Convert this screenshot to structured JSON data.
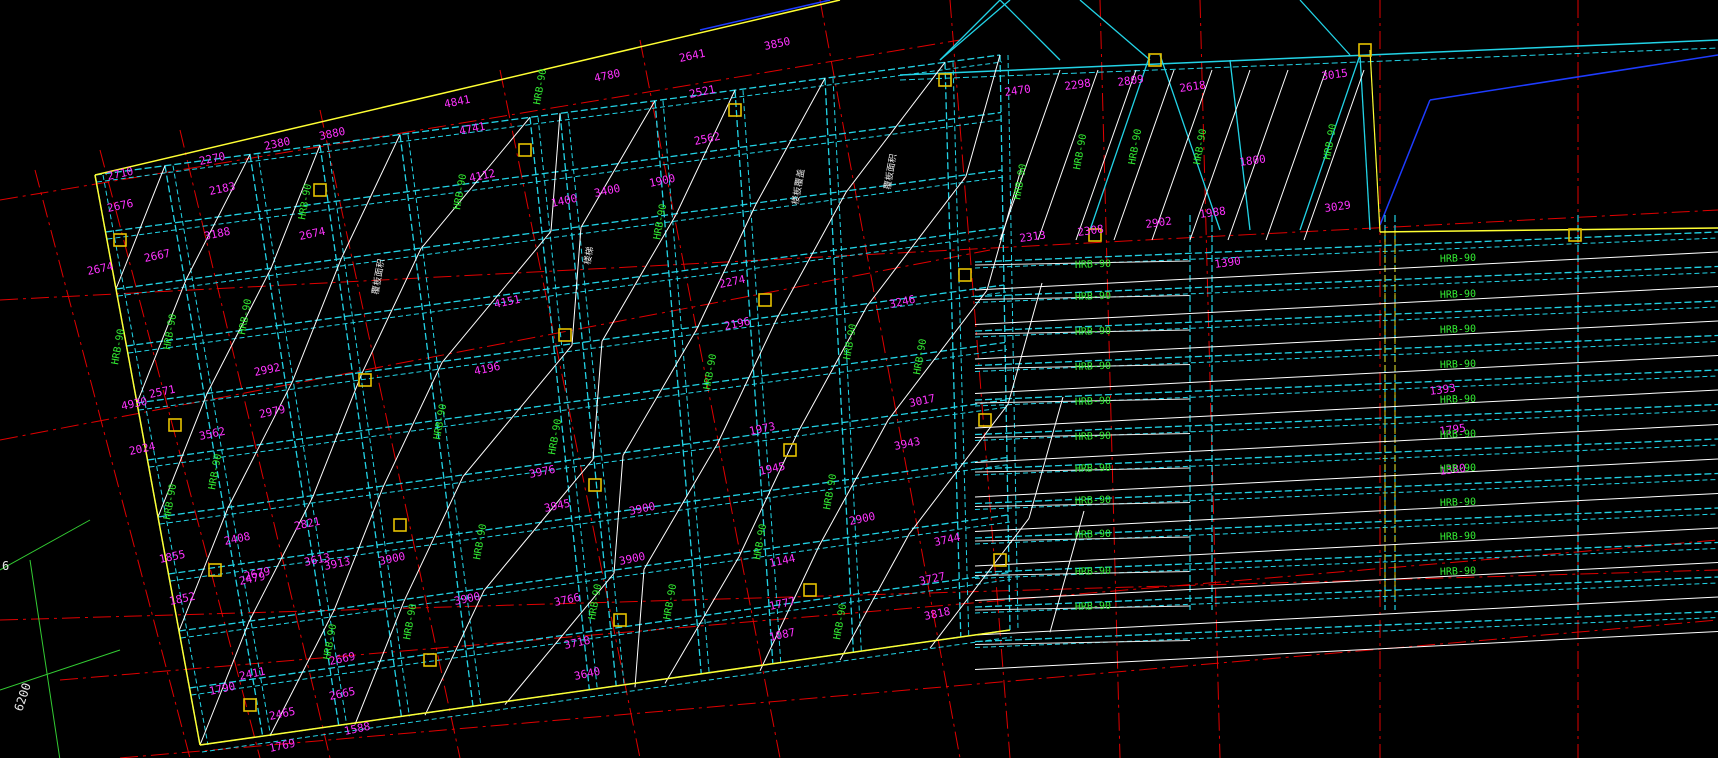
{
  "drawing": {
    "colors": {
      "background": "#000000",
      "grid_axis": "#e00000",
      "beam": "#22d3e6",
      "brace": "#ffffff",
      "dimension": "#ff33ff",
      "panel_label": "#33ee33",
      "outline": "#ffff33",
      "column": "#e6c200",
      "blue_line": "#1e3cff"
    },
    "axis_labels": [
      "6200",
      "6"
    ],
    "panel_label_text": "HRB-90",
    "dimensions_left": [
      "2710",
      "2676",
      "2674",
      "2667",
      "3188",
      "2270",
      "2183",
      "2380",
      "3880",
      "2571",
      "2992",
      "4930",
      "2979",
      "3562",
      "4741",
      "4112",
      "2674",
      "2679",
      "2024",
      "3613",
      "1855",
      "2408",
      "2821",
      "3913",
      "2479",
      "3900",
      "1852",
      "2411",
      "1790",
      "2669",
      "2665",
      "2465",
      "1588",
      "1769",
      "4151",
      "4196",
      "3976",
      "3945",
      "3766",
      "3718",
      "3640",
      "3900"
    ],
    "dimensions_center": [
      "4841",
      "4780",
      "2641",
      "3850",
      "2521",
      "2562",
      "1900",
      "3400",
      "1400",
      "2274",
      "2196",
      "3246",
      "3017",
      "1973",
      "1945",
      "2900",
      "1777",
      "1144",
      "3943",
      "1087",
      "3727",
      "3744",
      "3818",
      "3900",
      "3900"
    ],
    "dimensions_right": [
      "2470",
      "2298",
      "2809",
      "2618",
      "3015",
      "1988",
      "3029",
      "2313",
      "2308",
      "2902",
      "1800",
      "1390",
      "1393",
      "1795",
      "1380"
    ],
    "notes": [
      "覆板面积",
      "楼梯",
      "楼板覆盖"
    ]
  }
}
